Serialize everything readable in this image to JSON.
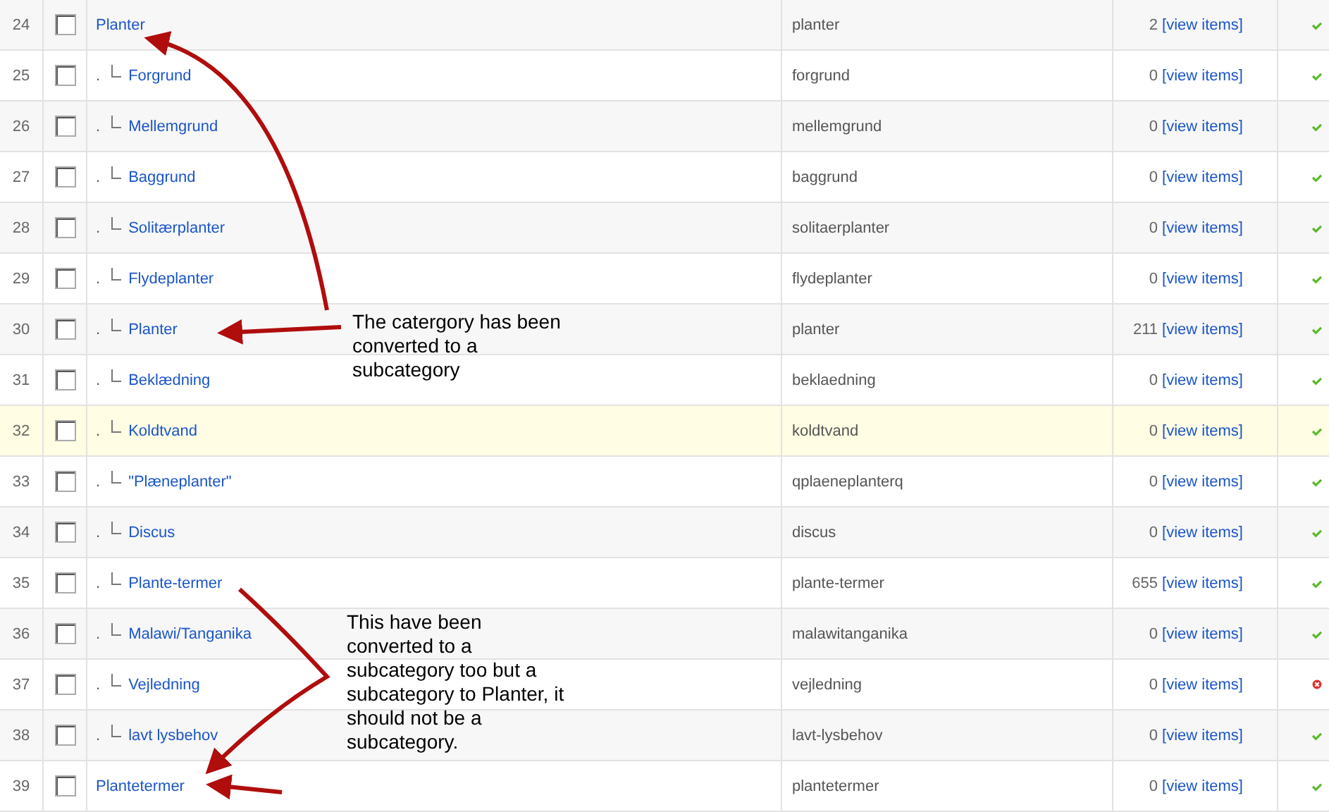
{
  "rows": [
    {
      "number": "24",
      "checked": false,
      "highlighted": false,
      "name": "Planter",
      "alias": "planter",
      "count": "2",
      "link": "[view items]",
      "published": true,
      "children": [
        {
          "number": "25",
          "checked": false,
          "highlighted": false,
          "prefix": ".",
          "name": "Forgrund",
          "alias": "forgrund",
          "count": "0",
          "link": "[view items]",
          "published": true
        },
        {
          "number": "26",
          "checked": false,
          "highlighted": false,
          "prefix": ".",
          "name": "Mellemgrund",
          "alias": "mellemgrund",
          "count": "0",
          "link": "[view items]",
          "published": true
        },
        {
          "number": "27",
          "checked": false,
          "highlighted": false,
          "prefix": ".",
          "name": "Baggrund",
          "alias": "baggrund",
          "count": "0",
          "link": "[view items]",
          "published": true
        },
        {
          "number": "28",
          "checked": false,
          "highlighted": false,
          "prefix": ".",
          "name": "Solitærplanter",
          "alias": "solitaerplanter",
          "count": "0",
          "link": "[view items]",
          "published": true
        },
        {
          "number": "29",
          "checked": false,
          "highlighted": false,
          "prefix": ".",
          "name": "Flydeplanter",
          "alias": "flydeplanter",
          "count": "0",
          "link": "[view items]",
          "published": true
        },
        {
          "number": "30",
          "checked": false,
          "highlighted": false,
          "prefix": ".",
          "name": "Planter",
          "alias": "planter",
          "count": "211",
          "link": "[view items]",
          "published": true
        },
        {
          "number": "31",
          "checked": false,
          "highlighted": false,
          "prefix": ".",
          "name": "Beklædning",
          "alias": "beklaedning",
          "count": "0",
          "link": "[view items]",
          "published": true
        },
        {
          "number": "32",
          "checked": false,
          "highlighted": true,
          "prefix": ".",
          "name": "Koldtvand",
          "alias": "koldtvand",
          "count": "0",
          "link": "[view items]",
          "published": true
        },
        {
          "number": "33",
          "checked": false,
          "highlighted": false,
          "prefix": ".",
          "name": "\"Plæneplanter\"",
          "alias": "qplaeneplanterq",
          "count": "0",
          "link": "[view items]",
          "published": true
        },
        {
          "number": "34",
          "checked": false,
          "highlighted": false,
          "prefix": ".",
          "name": "Discus",
          "alias": "discus",
          "count": "0",
          "link": "[view items]",
          "published": true
        },
        {
          "number": "35",
          "checked": false,
          "highlighted": false,
          "prefix": ".",
          "name": "Plante-termer",
          "alias": "plante-termer",
          "count": "655",
          "link": "[view items]",
          "published": true
        },
        {
          "number": "36",
          "checked": false,
          "highlighted": false,
          "prefix": ".",
          "name": "Malawi/Tanganika",
          "alias": "malawitanganika",
          "count": "0",
          "link": "[view items]",
          "published": true
        },
        {
          "number": "37",
          "checked": false,
          "highlighted": false,
          "prefix": ".",
          "name": "Vejledning",
          "alias": "vejledning",
          "count": "0",
          "link": "[view items]",
          "published": false
        },
        {
          "number": "38",
          "checked": false,
          "highlighted": false,
          "prefix": ".",
          "name": "lavt lysbehov",
          "alias": "lavt-lysbehov",
          "count": "0",
          "link": "[view items]",
          "published": true
        }
      ]
    },
    {
      "number": "39",
      "checked": false,
      "highlighted": false,
      "name": "Plantetermer",
      "alias": "plantetermer",
      "count": "0",
      "link": "[view items]",
      "published": true
    }
  ],
  "annotations": [
    {
      "text": "The catergory has been converted to a subcategory"
    },
    {
      "text": "This have been converted to a subcategory too but a subcategory to Planter, it should not be a subcategory."
    }
  ]
}
